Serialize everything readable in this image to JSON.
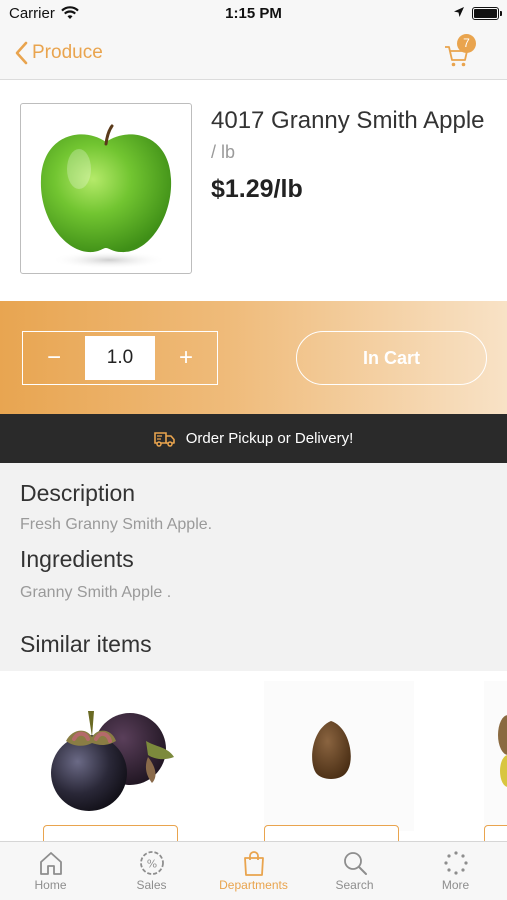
{
  "status_bar": {
    "carrier": "Carrier",
    "time": "1:15 PM"
  },
  "nav": {
    "back_label": "Produce",
    "cart_count": "7"
  },
  "product": {
    "name": "4017 Granny Smith Apple",
    "unit": "/ lb",
    "price": "$1.29/lb"
  },
  "cart_controls": {
    "minus": "−",
    "quantity": "1.0",
    "plus": "+",
    "in_cart_label": "In Cart"
  },
  "banner": {
    "text": "Order Pickup or Delivery!"
  },
  "description": {
    "heading": "Description",
    "text": "Fresh Granny Smith Apple."
  },
  "ingredients": {
    "heading": "Ingredients",
    "text": "Granny Smith Apple ."
  },
  "similar": {
    "heading": "Similar items"
  },
  "tabbar": {
    "items": [
      {
        "label": "Home",
        "icon": "home-icon"
      },
      {
        "label": "Sales",
        "icon": "sales-icon"
      },
      {
        "label": "Departments",
        "icon": "bag-icon"
      },
      {
        "label": "Search",
        "icon": "search-icon"
      },
      {
        "label": "More",
        "icon": "more-icon"
      }
    ],
    "active": "Departments"
  },
  "colors": {
    "accent": "#e9a44e",
    "banner_bg": "#2a2a2a"
  }
}
